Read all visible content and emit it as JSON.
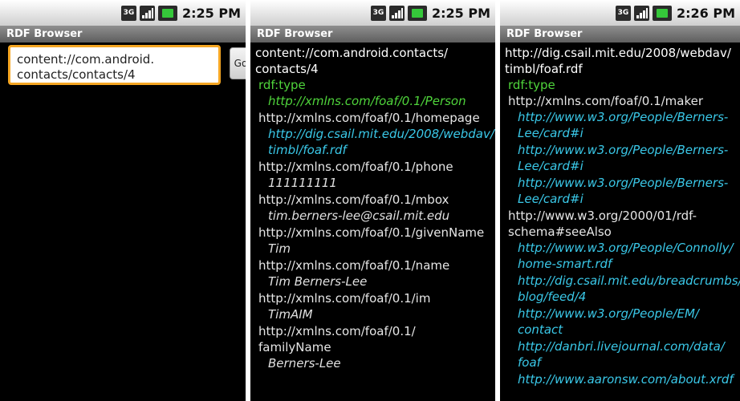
{
  "status": {
    "network": "3G",
    "times": [
      "2:25 PM",
      "2:25 PM",
      "2:26 PM"
    ]
  },
  "app_title": "RDF Browser",
  "screen1": {
    "url_value": "content://com.android.\ncontacts/contacts/4",
    "go_label": "Go"
  },
  "screen2": {
    "subject": [
      "content://com.android.contacts/",
      "contacts/4"
    ],
    "rows": [
      {
        "pred": [
          "rdf:type"
        ],
        "pred_style": "green",
        "obj": [
          "http://xmlns.com/foaf/0.1/Person"
        ],
        "obj_style": "green"
      },
      {
        "pred": [
          "http://xmlns.com/foaf/0.1/homepage"
        ],
        "obj": [
          "http://dig.csail.mit.edu/2008/webdav/",
          "timbl/foaf.rdf"
        ],
        "obj_style": "link"
      },
      {
        "pred": [
          "http://xmlns.com/foaf/0.1/phone"
        ],
        "obj": [
          "111111111"
        ],
        "obj_style": "lit"
      },
      {
        "pred": [
          "http://xmlns.com/foaf/0.1/mbox"
        ],
        "obj": [
          "tim.berners-lee@csail.mit.edu"
        ],
        "obj_style": "lit"
      },
      {
        "pred": [
          "http://xmlns.com/foaf/0.1/givenName"
        ],
        "obj": [
          "Tim"
        ],
        "obj_style": "lit"
      },
      {
        "pred": [
          "http://xmlns.com/foaf/0.1/name"
        ],
        "obj": [
          "Tim Berners-Lee"
        ],
        "obj_style": "lit"
      },
      {
        "pred": [
          "http://xmlns.com/foaf/0.1/im"
        ],
        "obj": [
          "TimAIM"
        ],
        "obj_style": "lit"
      },
      {
        "pred": [
          "http://xmlns.com/foaf/0.1/",
          "familyName"
        ],
        "obj": [
          "Berners-Lee"
        ],
        "obj_style": "lit"
      }
    ]
  },
  "screen3": {
    "subject": [
      "http://dig.csail.mit.edu/2008/webdav/",
      "timbl/foaf.rdf"
    ],
    "rows": [
      {
        "pred": [
          "rdf:type"
        ],
        "pred_style": "green",
        "obj": [],
        "obj_style": "green"
      },
      {
        "pred": [
          "http://xmlns.com/foaf/0.1/maker"
        ],
        "obj": [
          "http://www.w3.org/People/Berners-",
          "Lee/card#i"
        ],
        "obj_style": "link"
      },
      {
        "pred": [],
        "obj": [
          "http://www.w3.org/People/Berners-",
          "Lee/card#i"
        ],
        "obj_style": "link"
      },
      {
        "pred": [],
        "obj": [
          "http://www.w3.org/People/Berners-",
          "Lee/card#i"
        ],
        "obj_style": "link"
      },
      {
        "pred": [
          "http://www.w3.org/2000/01/rdf-",
          "schema#seeAlso"
        ],
        "obj": [
          "http://www.w3.org/People/Connolly/",
          "home-smart.rdf"
        ],
        "obj_style": "link"
      },
      {
        "pred": [],
        "obj": [
          "http://dig.csail.mit.edu/breadcrumbs/",
          "blog/feed/4"
        ],
        "obj_style": "link"
      },
      {
        "pred": [],
        "obj": [
          "http://www.w3.org/People/EM/",
          "contact"
        ],
        "obj_style": "link"
      },
      {
        "pred": [],
        "obj": [
          "http://danbri.livejournal.com/data/",
          "foaf"
        ],
        "obj_style": "link"
      },
      {
        "pred": [],
        "obj": [
          "http://www.aaronsw.com/about.xrdf"
        ],
        "obj_style": "link"
      }
    ]
  },
  "colors": {
    "link": "#3ac8e8",
    "rdf_type": "#4fd43b",
    "focus_border": "#f5a623"
  },
  "icons": [
    "network-3g-icon",
    "signal-icon",
    "battery-icon"
  ]
}
